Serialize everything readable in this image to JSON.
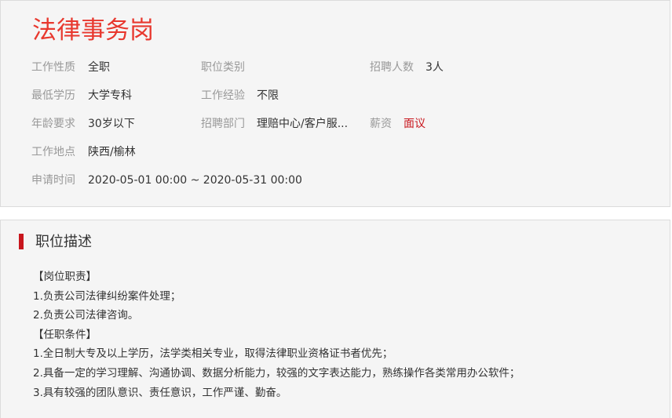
{
  "job": {
    "title": "法律事务岗",
    "fields": {
      "nature": {
        "label": "工作性质",
        "value": "全职"
      },
      "category": {
        "label": "职位类别",
        "value": ""
      },
      "headcount": {
        "label": "招聘人数",
        "value": "3人"
      },
      "education": {
        "label": "最低学历",
        "value": "大学专科"
      },
      "experience": {
        "label": "工作经验",
        "value": "不限"
      },
      "age": {
        "label": "年龄要求",
        "value": "30岁以下"
      },
      "department": {
        "label": "招聘部门",
        "value": "理赔中心/客户服..."
      },
      "salary": {
        "label": "薪资",
        "value": "面议"
      },
      "location": {
        "label": "工作地点",
        "value": "陕西/榆林"
      },
      "apply_time": {
        "label": "申请时间",
        "value": "2020-05-01 00:00 ~ 2020-05-31 00:00"
      }
    }
  },
  "description": {
    "heading": "职位描述",
    "lines": [
      "【岗位职责】",
      "1.负责公司法律纠纷案件处理；",
      "2.负责公司法律咨询。",
      "【任职条件】",
      "1.全日制大专及以上学历，法学类相关专业，取得法律职业资格证书者优先；",
      "2.具备一定的学习理解、沟通协调、数据分析能力，较强的文字表达能力，熟练操作各类常用办公软件；",
      "3.具有较强的团队意识、责任意识，工作严谨、勤奋。"
    ]
  },
  "colors": {
    "title": "#e8382e",
    "accent": "#c8161d",
    "panel_bg": "#f5f5f5"
  }
}
